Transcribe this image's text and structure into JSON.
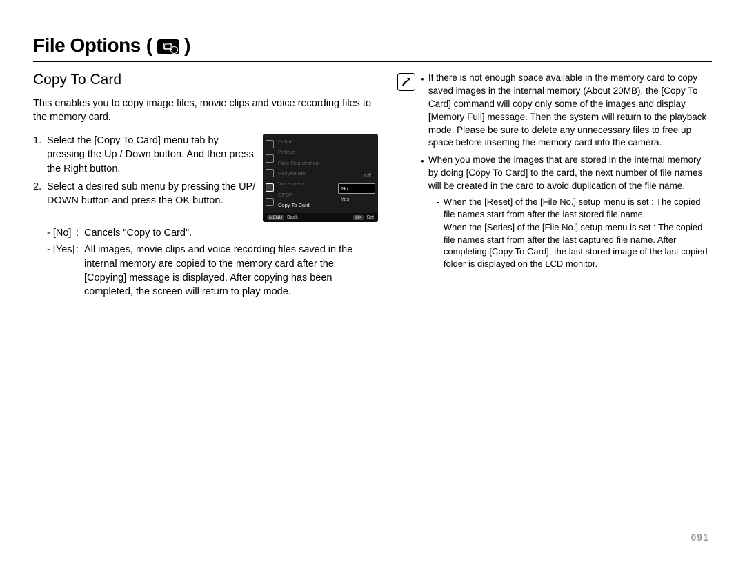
{
  "page_title": "File Options",
  "page_title_icon": "file-options-icon",
  "section_heading": "Copy To Card",
  "intro": "This enables you to copy image files, movie clips and voice recording files to the memory card.",
  "steps": [
    "Select the [Copy To Card] menu tab by pressing the Up / Down button. And then press the Right button.",
    "Select a desired sub menu by pressing the UP/ DOWN button and press the OK button."
  ],
  "options": [
    {
      "tag": "- [No]",
      "desc": "Cancels \"Copy to Card\"."
    },
    {
      "tag": "- [Yes]",
      "desc": "All images, movie clips and voice recording files saved in the internal memory are copied to the memory card after the [Copying] message is displayed. After copying has been completed, the screen will return to play mode."
    }
  ],
  "lcd": {
    "menu_items": [
      {
        "label": "Delete",
        "active": false
      },
      {
        "label": "Protect",
        "active": false
      },
      {
        "label": "Face Registration",
        "active": false
      },
      {
        "label": "Recycle Bin",
        "active": false,
        "value": "Off"
      },
      {
        "label": "Voice memo",
        "active": false
      },
      {
        "label": "DPOF",
        "active": false
      },
      {
        "label": "Copy To Card",
        "active": true
      }
    ],
    "submenu": [
      {
        "label": "No",
        "selected": true
      },
      {
        "label": "Yes",
        "selected": false
      }
    ],
    "footer": {
      "back_btn": "MENU",
      "back_label": "Back",
      "set_btn": "OK",
      "set_label": "Set"
    }
  },
  "notes": [
    {
      "text": "If there is not enough space available in the memory card to copy saved images in the internal memory (About 20MB), the [Copy To Card] command will copy only some of the images and display [Memory Full] message. Then the system will return to the playback mode. Please be sure to delete any unnecessary files to free up space before inserting the memory card into the camera.",
      "sub": []
    },
    {
      "text": "When you move the images that are stored in the internal memory by doing [Copy To Card] to the card, the next number of file names will be created in the card to avoid duplication of the file name.",
      "sub": [
        "When the [Reset] of the [File No.] setup menu is set : The copied file names start from after the last stored file name.",
        "When the [Series] of the [File No.] setup menu is set : The copied file names start from after the last captured file name. After completing [Copy To Card], the last stored image of the last copied folder is displayed on the LCD monitor."
      ]
    }
  ],
  "page_number": "091"
}
